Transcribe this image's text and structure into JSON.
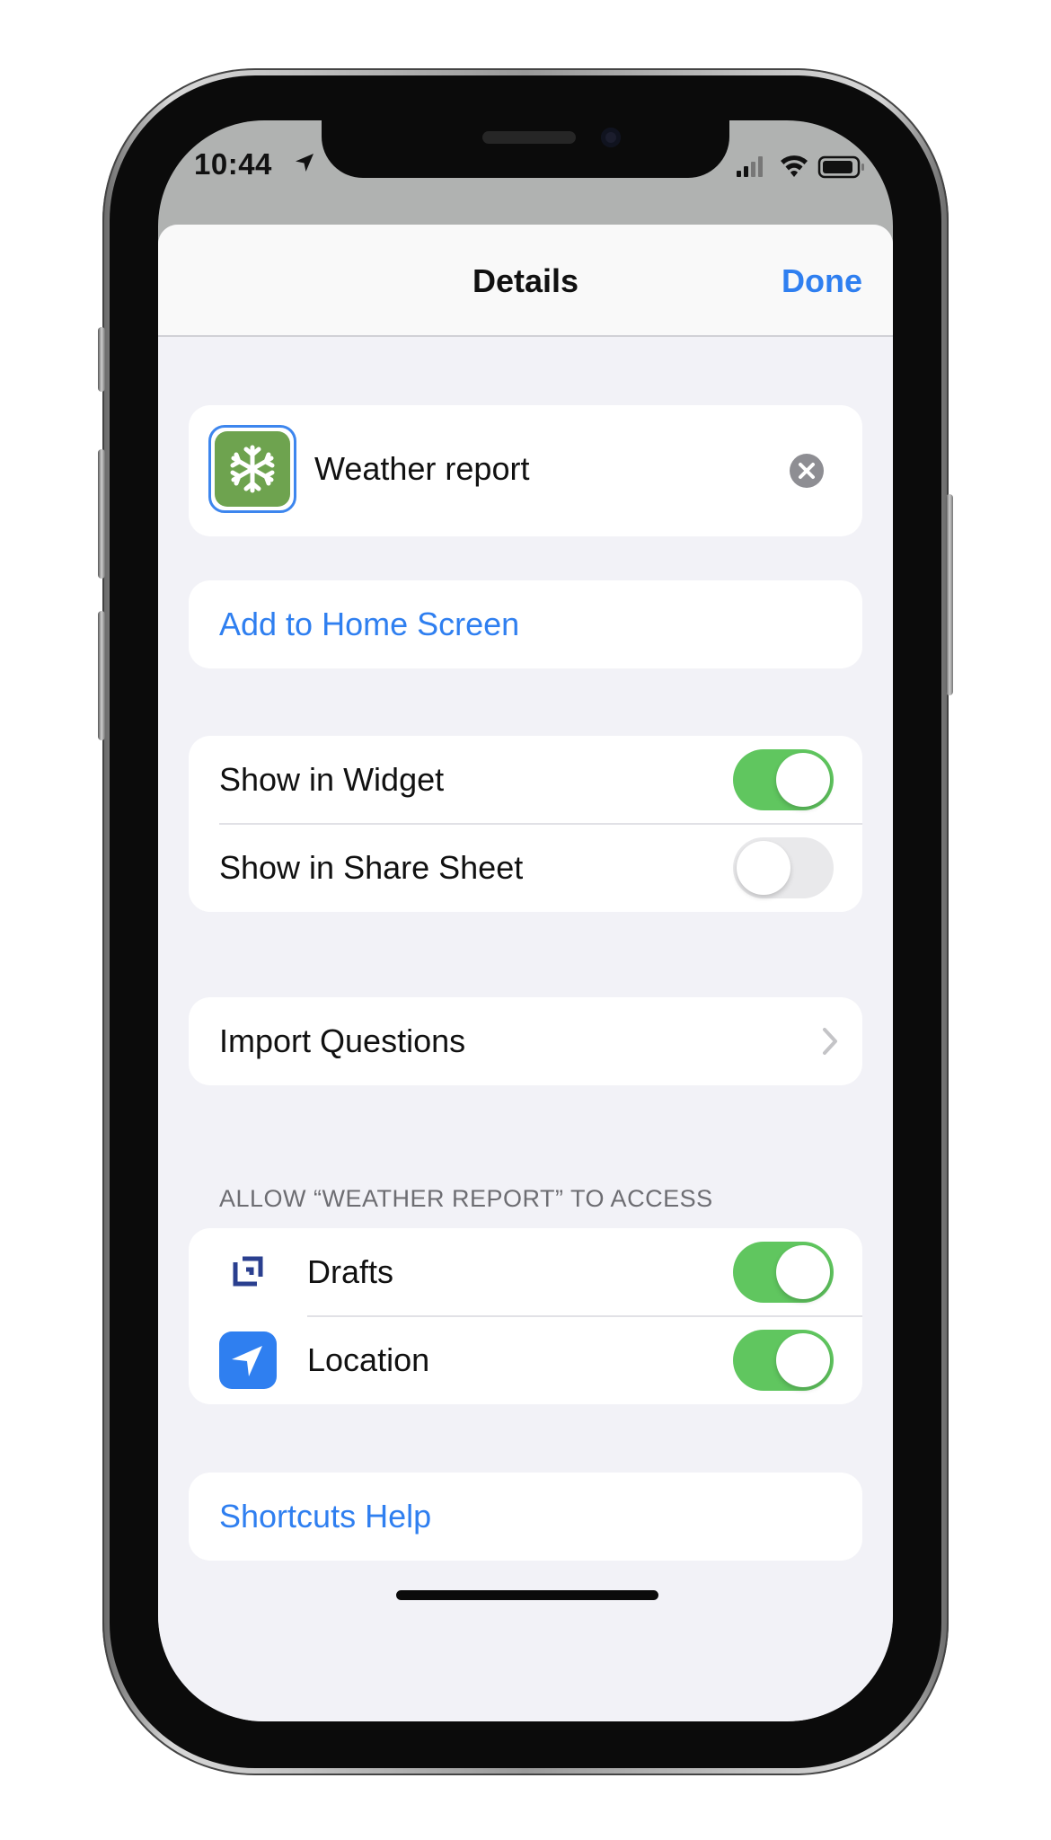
{
  "status_bar": {
    "time": "10:44"
  },
  "navbar": {
    "title": "Details",
    "done_label": "Done"
  },
  "shortcut": {
    "name": "Weather report",
    "icon": "snowflake-icon",
    "icon_color": "#6ea34f"
  },
  "add_to_home": {
    "label": "Add to Home Screen"
  },
  "visibility": {
    "show_in_widget": {
      "label": "Show in Widget",
      "enabled": true
    },
    "show_in_share_sheet": {
      "label": "Show in Share Sheet",
      "enabled": false
    }
  },
  "import_questions": {
    "label": "Import Questions"
  },
  "access": {
    "header": "ALLOW “WEATHER REPORT” TO ACCESS",
    "items": [
      {
        "label": "Drafts",
        "icon": "drafts-icon",
        "enabled": true
      },
      {
        "label": "Location",
        "icon": "location-arrow-icon",
        "enabled": true
      }
    ]
  },
  "help": {
    "label": "Shortcuts Help"
  },
  "colors": {
    "accent": "#2f7ff0",
    "toggle_on": "#60c65f",
    "background": "#f2f2f7"
  }
}
